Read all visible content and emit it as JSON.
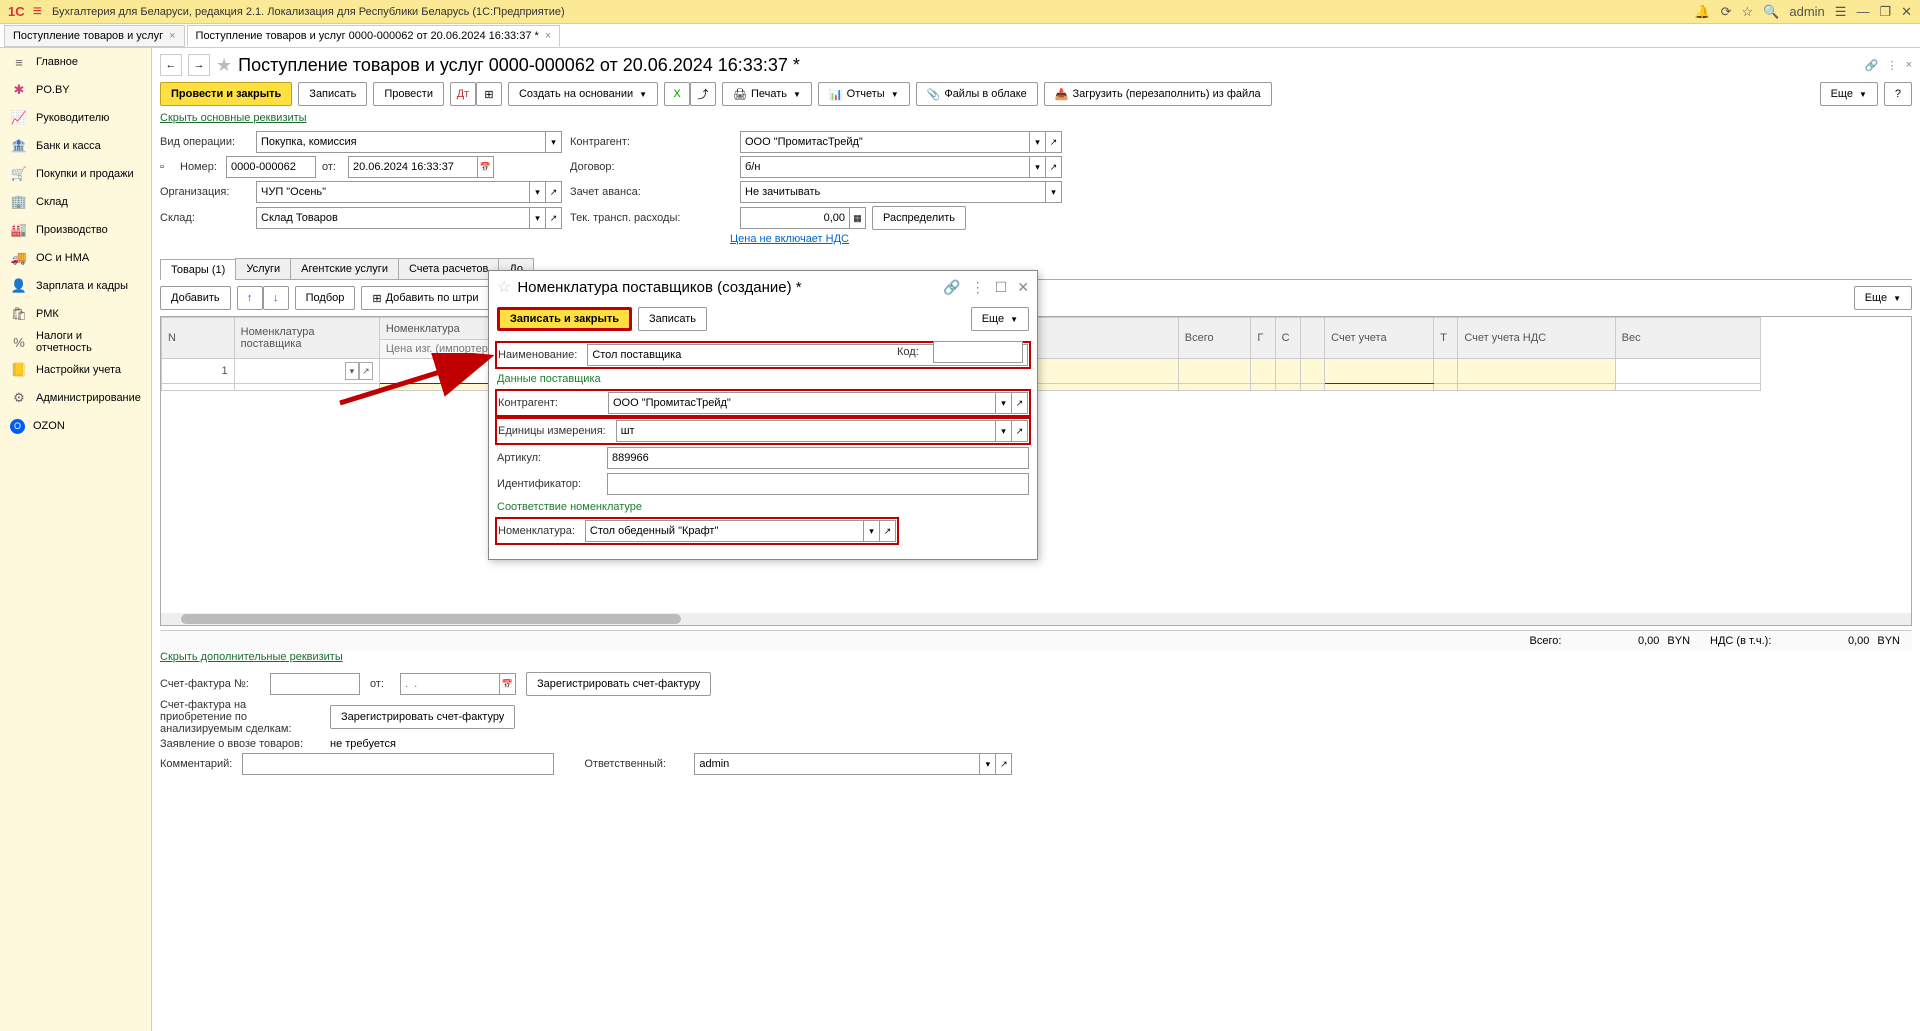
{
  "titlebar": {
    "logo": "1C",
    "title": "Бухгалтерия для Беларуси, редакция 2.1. Локализация для Республики Беларусь   (1С:Предприятие)",
    "user": "admin"
  },
  "tabs": [
    {
      "label": "Поступление товаров и услуг",
      "active": false
    },
    {
      "label": "Поступление товаров и услуг 0000-000062 от 20.06.2024 16:33:37 *",
      "active": true
    }
  ],
  "sidebar": [
    {
      "icon": "≡",
      "label": "Главное"
    },
    {
      "icon": "✱",
      "label": "PO.BY",
      "pink": true
    },
    {
      "icon": "📈",
      "label": "Руководителю"
    },
    {
      "icon": "🏦",
      "label": "Банк и касса"
    },
    {
      "icon": "🛒",
      "label": "Покупки и продажи"
    },
    {
      "icon": "🏢",
      "label": "Склад"
    },
    {
      "icon": "🏭",
      "label": "Производство"
    },
    {
      "icon": "🚚",
      "label": "ОС и НМА"
    },
    {
      "icon": "👤",
      "label": "Зарплата и кадры"
    },
    {
      "icon": "🛍",
      "label": "РМК"
    },
    {
      "icon": "%",
      "label": "Налоги и отчетность"
    },
    {
      "icon": "📒",
      "label": "Настройки учета"
    },
    {
      "icon": "⚙",
      "label": "Администрирование"
    },
    {
      "icon": "O",
      "label": "OZON",
      "ozon": true
    }
  ],
  "page": {
    "heading": "Поступление товаров и услуг 0000-000062 от 20.06.2024 16:33:37 *"
  },
  "toolbar": {
    "post_close": "Провести и закрыть",
    "write": "Записать",
    "post": "Провести",
    "create_based": "Создать на основании",
    "print": "Печать",
    "reports": "Отчеты",
    "files_cloud": "Файлы в облаке",
    "load_file": "Загрузить (перезаполнить) из файла",
    "more": "Еще",
    "help": "?"
  },
  "links": {
    "hide_main": "Скрыть основные реквизиты",
    "price_no_vat": "Цена не включает НДС",
    "hide_extra": "Скрыть дополнительные реквизиты"
  },
  "requisites": {
    "op_type_label": "Вид операции:",
    "op_type": "Покупка, комиссия",
    "number_label": "Номер:",
    "number": "0000-000062",
    "date_label": "от:",
    "date": "20.06.2024 16:33:37",
    "org_label": "Организация:",
    "org": "ЧУП \"Осень\"",
    "warehouse_label": "Склад:",
    "warehouse": "Склад Товаров",
    "counterparty_label": "Контрагент:",
    "counterparty": "ООО \"ПромитасТрейд\"",
    "contract_label": "Договор:",
    "contract": "б/н",
    "advance_label": "Зачет аванса:",
    "advance": "Не зачитывать",
    "transport_label": "Тек. трансп. расходы:",
    "transport": "0,00",
    "distribute": "Распределить"
  },
  "subtabs": [
    "Товары (1)",
    "Услуги",
    "Агентские услуги",
    "Счета расчетов",
    "До"
  ],
  "tbltoolbar": {
    "add": "Добавить",
    "pick": "Подбор",
    "add_barcode": "Добавить по штри",
    "more": "Еще"
  },
  "grid": {
    "headers": [
      "N",
      "Номенклатура поставщика",
      "Номенклатура",
      "",
      "",
      "Всего",
      "Г",
      "С",
      "",
      "Счет учета",
      "Т",
      "Счет учета НДС",
      "Вес"
    ],
    "subheader_price": "Цена изг. (импортера)",
    "row_n": "1"
  },
  "bottom": {
    "total_label": "Всего:",
    "total_val": "0,00",
    "currency": "BYN",
    "vat_label": "НДС (в т.ч.):",
    "vat_val": "0,00"
  },
  "footer": {
    "invoice_label": "Счет-фактура №:",
    "from_label": "от:",
    "date_placeholder": ".  .",
    "register_invoice": "Зарегистрировать счет-фактуру",
    "invoice_deals_label": "Счет-фактура на приобретение по анализируемым сделкам:",
    "register_invoice2": "Зарегистрировать счет-фактуру",
    "import_decl_label": "Заявление о ввозе товаров:",
    "import_decl_val": "не требуется",
    "comment_label": "Комментарий:",
    "responsible_label": "Ответственный:",
    "responsible": "admin"
  },
  "dialog": {
    "title": "Номенклатура поставщиков (создание) *",
    "save_close": "Записать и закрыть",
    "write": "Записать",
    "more": "Еще",
    "name_label": "Наименование:",
    "name": "Стол поставщика",
    "code_label": "Код:",
    "section_supplier": "Данные поставщика",
    "counterparty_label": "Контрагент:",
    "counterparty": "ООО \"ПромитасТрейд\"",
    "unit_label": "Единицы измерения:",
    "unit": "шт",
    "article_label": "Артикул:",
    "article": "889966",
    "id_label": "Идентификатор:",
    "section_match": "Соответствие номенклатуре",
    "nomenclature_label": "Номенклатура:",
    "nomenclature": "Стол обеденный \"Крафт\""
  }
}
